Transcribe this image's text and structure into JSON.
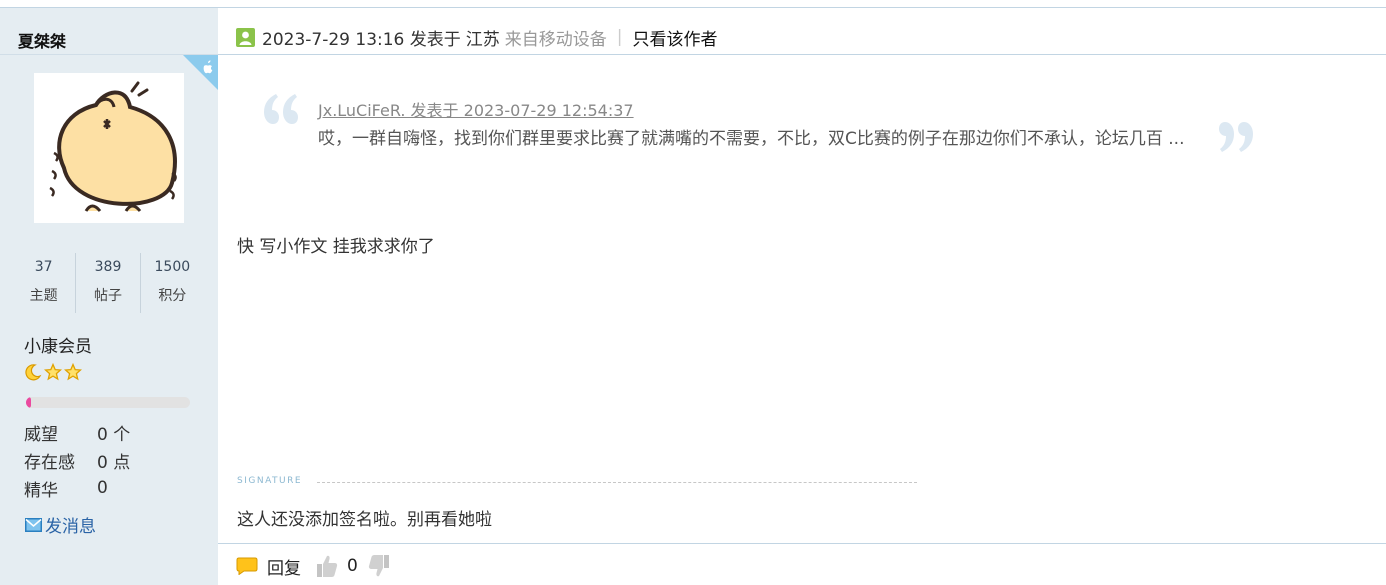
{
  "author": {
    "name": "夏桀桀",
    "avatar_icon": "hamster-back-avatar",
    "stats": [
      {
        "value": "37",
        "label": "主题"
      },
      {
        "value": "389",
        "label": "帖子"
      },
      {
        "value": "1500",
        "label": "积分"
      }
    ],
    "group": "小康会员",
    "rank_icons": [
      "moon-icon",
      "star-icon",
      "star-icon"
    ],
    "progress_fraction": 0.03,
    "profile": [
      {
        "key": "威望",
        "value": "0 个"
      },
      {
        "key": "存在感",
        "value": "0 点"
      },
      {
        "key": "精华",
        "value": "0"
      }
    ],
    "pm_label": "发消息",
    "pm_icon": "envelope-icon"
  },
  "post": {
    "online_icon": "user-online-icon",
    "time": "2023-7-29 13:16 发表于",
    "location": "江苏",
    "source": "来自移动设备",
    "separator": "|",
    "only_author": "只看该作者",
    "device_icon": "apple-icon",
    "quote": {
      "source": "Jx.LuCiFeR. 发表于 2023-07-29 12:54:37",
      "text": "哎，一群自嗨怪，找到你们群里要求比赛了就满嘴的不需要，不比，双C比赛的例子在那边你们不承认，论坛几百 ..."
    },
    "body": "快 写小作文 挂我求求你了",
    "signature_label": "SIGNATURE",
    "signature": "这人还没添加签名啦。别再看她啦"
  },
  "footer": {
    "reply_label": "回复",
    "reply_icon": "reply-bubble-icon",
    "support_icon": "thumb-up-icon",
    "support_count": "0",
    "against_icon": "thumb-down-icon"
  },
  "colors": {
    "sidebar_bg": "#e5edf2",
    "rule": "#c2d5e3",
    "link": "#2a63a6",
    "progress": "#ea4aa0",
    "quote_mark": "#dce8f2"
  }
}
